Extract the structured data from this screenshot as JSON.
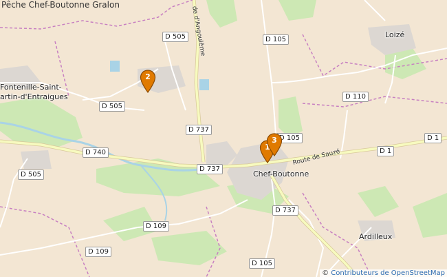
{
  "page": {
    "title": "Pêche Chef-Boutonne Gralon"
  },
  "places": {
    "fontenille_line1": "Fontenille-Saint-",
    "fontenille_line2": "artin-d'Entraigues",
    "loize": "Loizé",
    "chef_boutonne": "Chef-Boutonne",
    "ardilleux": "Ardilleux"
  },
  "street_labels": {
    "route_de_sauze": "Route de Sauzé",
    "route_angouleme": "de d'Angoulême"
  },
  "road_labels": {
    "d505_top": "D 505",
    "d105_top": "D 105",
    "d505_mid": "D 505",
    "d110": "D 110",
    "d737_n": "D 737",
    "d105_center": "D 105",
    "d1_a": "D 1",
    "d1_b": "D 1",
    "d740": "D 740",
    "d737_w": "D 737",
    "d505_sw": "D 505",
    "d737_s": "D 737",
    "d109_a": "D 109",
    "d109_b": "D 109",
    "d105_s": "D 105"
  },
  "markers": [
    {
      "label": "2",
      "color": "#e07a00"
    },
    {
      "label": "1",
      "color": "#e07a00"
    },
    {
      "label": "3",
      "color": "#e07a00"
    }
  ],
  "attribution": {
    "symbol": "©",
    "link_text": "Contributeurs de OpenStreetMap"
  },
  "colors": {
    "land": "#f3e6d3",
    "forest": "#cde8b4",
    "water": "#a9d3e6",
    "road_major": "#f7fabf",
    "boundary": "#c77fc1"
  }
}
